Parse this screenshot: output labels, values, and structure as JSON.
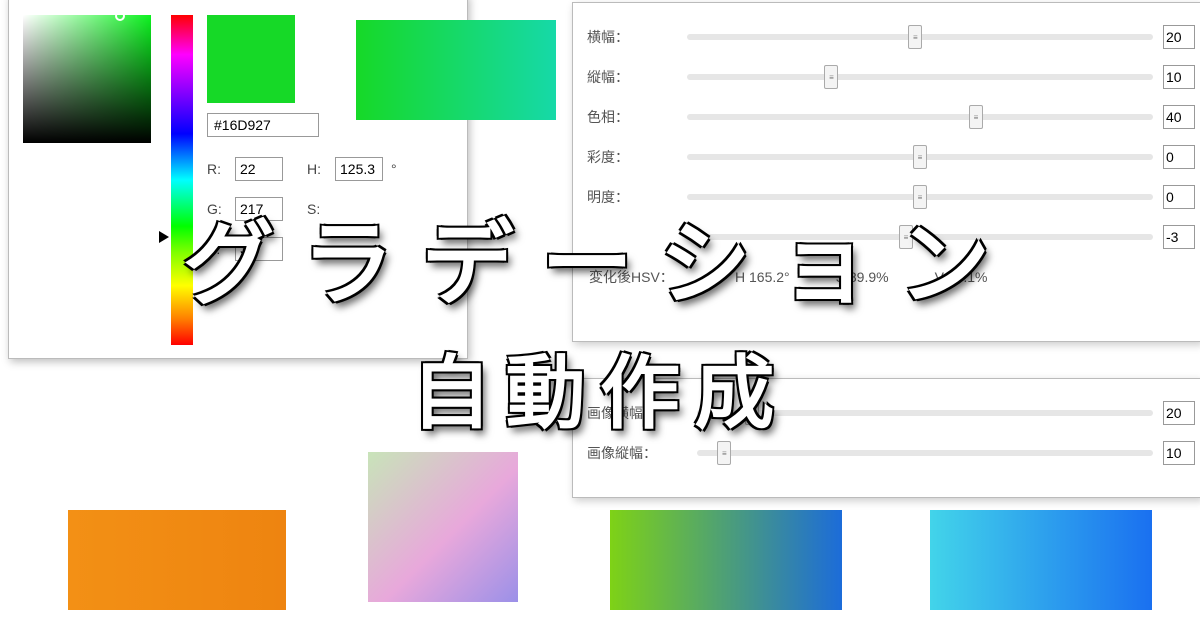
{
  "headline": {
    "line1": "グラデーション",
    "line2": "自動作成"
  },
  "picker": {
    "hex": "#16D927",
    "r_label": "R:",
    "r": "22",
    "g_label": "G:",
    "g": "217",
    "b_label": "B:",
    "b": "39",
    "h_label": "H:",
    "h": "125.3",
    "h_unit": "°",
    "s_label": "S:",
    "swatch_color": "#16D927"
  },
  "sliders": {
    "width": {
      "label": "横幅：",
      "value": "20",
      "pos": 49
    },
    "height": {
      "label": "縦幅：",
      "value": "10",
      "pos": 31
    },
    "hue": {
      "label": "色相：",
      "value": "40",
      "pos": 62
    },
    "saturation": {
      "label": "彩度：",
      "value": "0",
      "pos": 50
    },
    "value": {
      "label": "明度：",
      "value": "0",
      "pos": 50
    },
    "extra": {
      "label": "",
      "value": "-3",
      "pos": 47
    }
  },
  "readout": {
    "label": "変化後HSV：",
    "h": "H 165.2°",
    "s": "S 89.9%",
    "v": "V 85.1%"
  },
  "sliders2": {
    "img_w": {
      "label": "画像横幅：",
      "value": "20",
      "pos": 12
    },
    "img_h": {
      "label": "画像縦幅：",
      "value": "10",
      "pos": 6
    }
  },
  "swatches": {
    "top_gradient": {
      "from": "#16D927",
      "to": "#16D9A8"
    },
    "orange": {
      "from": "#f39015",
      "to": "#ee8410"
    },
    "pink": {
      "from": "#c8e4b9",
      "mid": "#e8a8db",
      "to": "#9b90e8"
    },
    "green_blue": {
      "from": "#7ed216",
      "to": "#1c6cd9"
    },
    "cyan_blue": {
      "from": "#42d4ea",
      "to": "#1a70f0"
    }
  }
}
